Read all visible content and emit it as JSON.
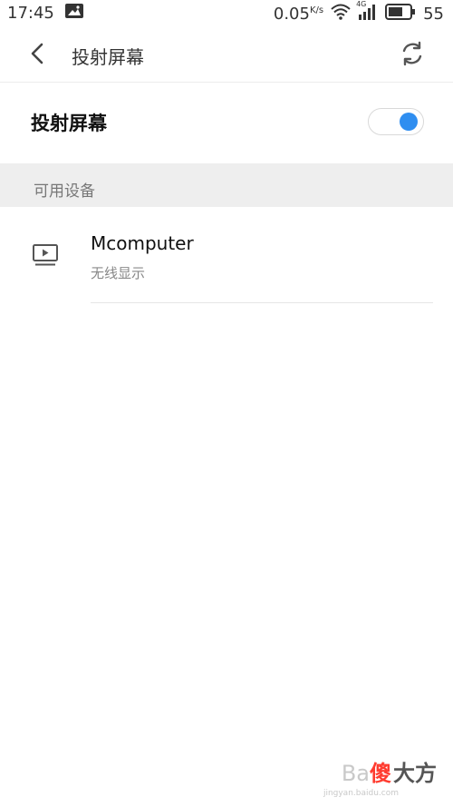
{
  "statusbar": {
    "time": "17:45",
    "speed": "0.05",
    "speed_unit": "K/s",
    "network": "4G",
    "battery": "55",
    "icons": [
      "image-icon",
      "wifi-icon",
      "signal-icon",
      "battery-icon"
    ]
  },
  "toolbar": {
    "title": "投射屏幕",
    "back_icon": "chevron-left-icon",
    "refresh_icon": "refresh-icon"
  },
  "cast_toggle": {
    "label": "投射屏幕",
    "enabled": true,
    "accent": "#2f8ef0"
  },
  "section": {
    "title": "可用设备"
  },
  "devices": [
    {
      "name": "Mcomputer",
      "type": "无线显示",
      "icon": "display-play-icon"
    }
  ],
  "watermark": {
    "text_gray": "Ba",
    "text_accent": "傻",
    "text_rest": "大方",
    "sub": "jingyan.baidu.com"
  }
}
